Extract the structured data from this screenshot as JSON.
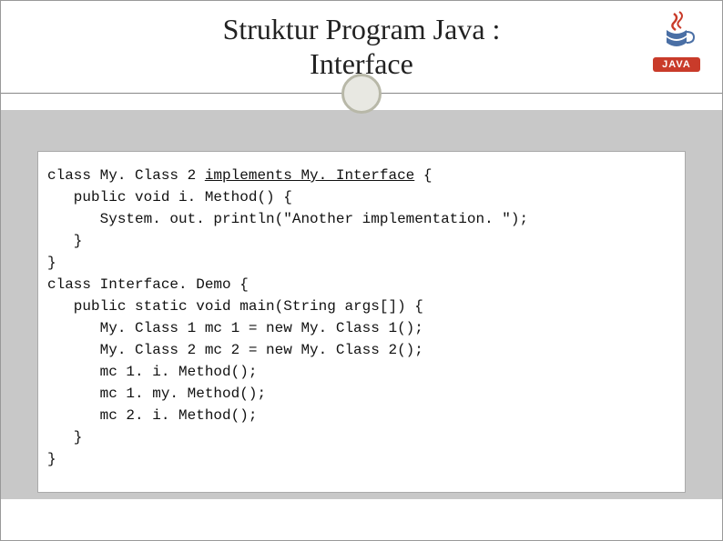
{
  "title_line1": "Struktur Program Java :",
  "title_line2": "Interface",
  "logo_label": "JAVA",
  "code": {
    "l1a": "class My. Class 2 ",
    "l1b": "implements My. Interface",
    "l1c": " {",
    "l2": "   public void i. Method() {",
    "l3": "      System. out. println(\"Another implementation. \");",
    "l4": "   }",
    "l5": "}",
    "l6": "class Interface. Demo {",
    "l7": "   public static void main(String args[]) {",
    "l8": "      My. Class 1 mc 1 = new My. Class 1();",
    "l9": "      My. Class 2 mc 2 = new My. Class 2();",
    "l10": "      mc 1. i. Method();",
    "l11": "      mc 1. my. Method();",
    "l12": "      mc 2. i. Method();",
    "l13": "   }",
    "l14": "}"
  }
}
